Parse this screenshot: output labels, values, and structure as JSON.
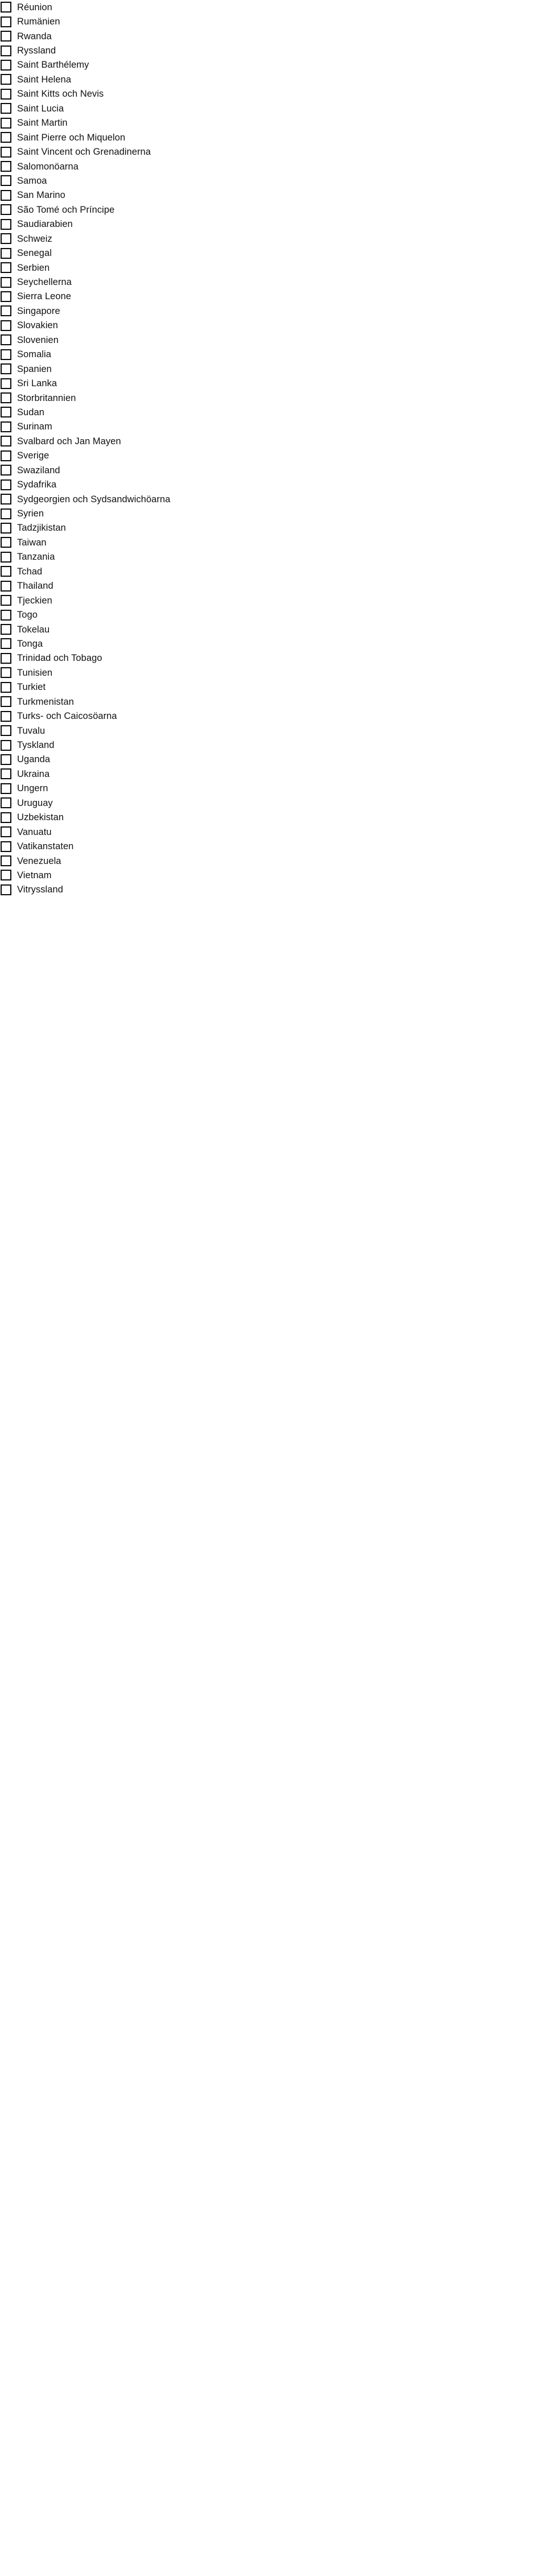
{
  "document": {
    "type": "checkbox-list",
    "kind": "country-selection-list",
    "language": "sv",
    "checkbox_state": "unchecked",
    "colors": {
      "background": "#ffffff",
      "text": "#111111",
      "checkbox_border": "#0a0a0a"
    }
  },
  "list": {
    "items": [
      "Réunion",
      "Rumänien",
      "Rwanda",
      "Ryssland",
      "Saint Barthélemy",
      "Saint Helena",
      "Saint Kitts och Nevis",
      "Saint Lucia",
      "Saint Martin",
      "Saint Pierre och Miquelon",
      "Saint Vincent och Grenadinerna",
      "Salomonöarna",
      "Samoa",
      "San Marino",
      "São Tomé och Príncipe",
      "Saudiarabien",
      "Schweiz",
      "Senegal",
      "Serbien",
      "Seychellerna",
      "Sierra Leone",
      "Singapore",
      "Slovakien",
      "Slovenien",
      "Somalia",
      "Spanien",
      "Sri Lanka",
      "Storbritannien",
      "Sudan",
      "Surinam",
      "Svalbard och Jan Mayen",
      "Sverige",
      "Swaziland",
      "Sydafrika",
      "Sydgeorgien och Sydsandwichöarna",
      "Syrien",
      "Tadzjikistan",
      "Taiwan",
      "Tanzania",
      "Tchad",
      "Thailand",
      "Tjeckien",
      "Togo",
      "Tokelau",
      "Tonga",
      "Trinidad och Tobago",
      "Tunisien",
      "Turkiet",
      "Turkmenistan",
      "Turks- och Caicosöarna",
      "Tuvalu",
      "Tyskland",
      "Uganda",
      "Ukraina",
      "Ungern",
      "Uruguay",
      "Uzbekistan",
      "Vanuatu",
      "Vatikanstaten",
      "Venezuela",
      "Vietnam",
      "Vitryssland"
    ]
  }
}
